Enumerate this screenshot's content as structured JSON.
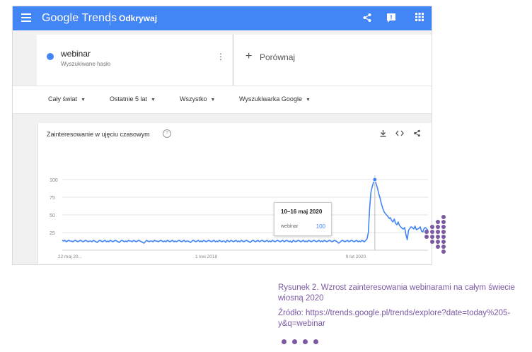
{
  "header": {
    "logo": "Google Trends",
    "nav_explore": "Odkrywaj",
    "icons": [
      "menu-icon",
      "share-icon",
      "feedback-icon",
      "apps-icon"
    ]
  },
  "search_term": {
    "name": "webinar",
    "type": "Wyszukiwane hasło",
    "color": "#4285f4"
  },
  "compare": {
    "plus": "+",
    "label": "Porównaj"
  },
  "filters": [
    {
      "label": "Cały świat"
    },
    {
      "label": "Ostatnie 5 lat"
    },
    {
      "label": "Wszystko"
    },
    {
      "label": "Wyszukiwarka Google"
    }
  ],
  "chart_card": {
    "title": "Zainteresowanie w ujęciu czasowym",
    "icons": [
      "help-icon",
      "download-icon",
      "embed-icon",
      "share-icon"
    ]
  },
  "tooltip": {
    "date": "10–16 maj 2020",
    "term": "webinar",
    "value": "100"
  },
  "chart_data": {
    "type": "line",
    "title": "Zainteresowanie w ujęciu czasowym",
    "ylim": [
      0,
      100
    ],
    "yticks": [
      "100",
      "75",
      "50",
      "25"
    ],
    "xticks": [
      "22 maj 20...",
      "1 kwi 2018",
      "9 lut 2020"
    ],
    "grid": true,
    "series": [
      {
        "name": "webinar",
        "color": "#4285f4",
        "x_start": "2015-05-22",
        "step": "week",
        "values": [
          14,
          13,
          14,
          12,
          13,
          14,
          13,
          13,
          12,
          13,
          14,
          13,
          12,
          13,
          14,
          13,
          12,
          13,
          14,
          13,
          12,
          13,
          13,
          12,
          14,
          13,
          12,
          11,
          13,
          14,
          13,
          12,
          13,
          14,
          12,
          13,
          12,
          14,
          13,
          12,
          13,
          14,
          13,
          12,
          11,
          13,
          14,
          13,
          12,
          13,
          12,
          14,
          13,
          13,
          12,
          14,
          13,
          12,
          13,
          14,
          13,
          12,
          11,
          10,
          12,
          14,
          13,
          12,
          13,
          13,
          12,
          14,
          13,
          13,
          12,
          13,
          14,
          13,
          12,
          13,
          12,
          14,
          13,
          12,
          13,
          14,
          12,
          13,
          12,
          13,
          14,
          13,
          12,
          13,
          14,
          12,
          13,
          13,
          12,
          11,
          13,
          14,
          13,
          12,
          13,
          14,
          12,
          13,
          12,
          14,
          13,
          12,
          13,
          14,
          13,
          12,
          13,
          14,
          12,
          13,
          12,
          14,
          13,
          12,
          13,
          13,
          11,
          14,
          13,
          12,
          14,
          13,
          12,
          13,
          14,
          12,
          13,
          12,
          14,
          13,
          12,
          13,
          14,
          13,
          12,
          11,
          13,
          14,
          13,
          12,
          13,
          14,
          12,
          13,
          14,
          13,
          12,
          13,
          14,
          12,
          13,
          12,
          14,
          13,
          12,
          13,
          14,
          13,
          12,
          13,
          14,
          12,
          13,
          14,
          13,
          12,
          13,
          11,
          14,
          13,
          12,
          13,
          14,
          13,
          12,
          13,
          14,
          12,
          13,
          12,
          14,
          13,
          12,
          13,
          14,
          13,
          12,
          13,
          14,
          12,
          13,
          12,
          14,
          13,
          12,
          13,
          14,
          13,
          12,
          13,
          14,
          13,
          12,
          10,
          11,
          13,
          14,
          13,
          12,
          13,
          14,
          12,
          13,
          14,
          13,
          12,
          13,
          14,
          12,
          13,
          12,
          14,
          13,
          12,
          14,
          16,
          25,
          60,
          82,
          90,
          96,
          100,
          94,
          88,
          80,
          74,
          66,
          60,
          55,
          52,
          50,
          48,
          45,
          46,
          42,
          40,
          44,
          38,
          36,
          40,
          35,
          33,
          31,
          30,
          32,
          22,
          15,
          28,
          31,
          33,
          32,
          30,
          34,
          29,
          30,
          31,
          33,
          27,
          26,
          31,
          32,
          30,
          28
        ]
      }
    ]
  },
  "caption": {
    "figure": "Rysunek 2. Wzrost zainteresowania webinarami na całym świecie wiosną 2020",
    "source": "Źródło: https://trends.google.pl/trends/explore?date=today%205-y&q=webinar"
  }
}
